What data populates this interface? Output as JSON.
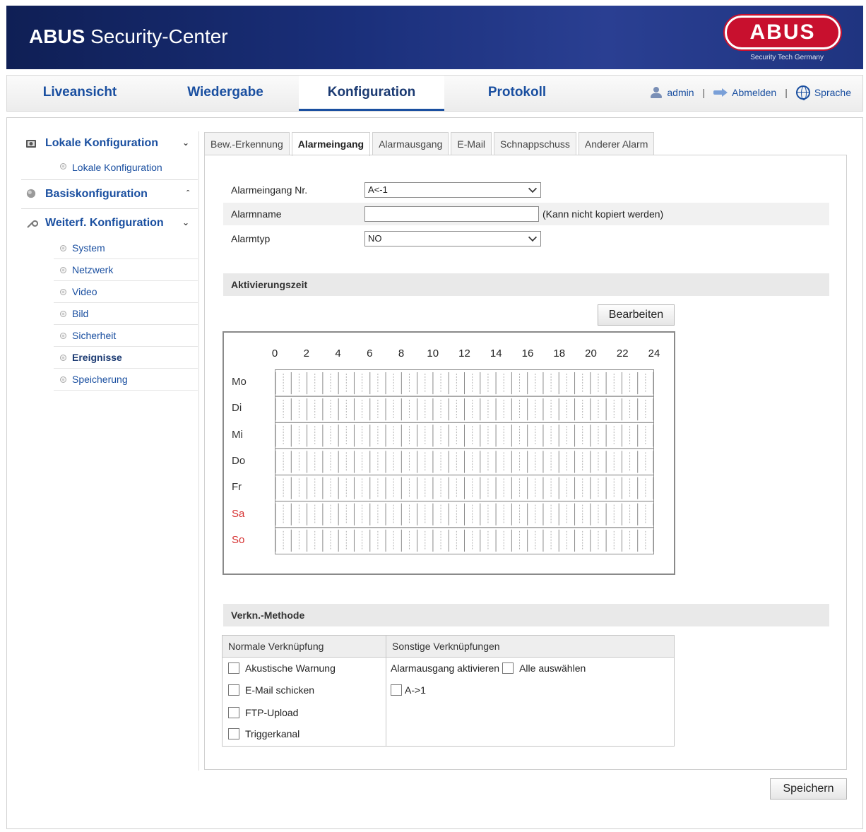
{
  "header": {
    "title_bold": "ABUS",
    "title_rest": " Security-Center",
    "logo_text": "ABUS",
    "logo_subtitle": "Security Tech Germany",
    "logo_color": "#c8102e"
  },
  "topnav": {
    "tabs": [
      {
        "label": "Liveansicht"
      },
      {
        "label": "Wiedergabe"
      },
      {
        "label": "Konfiguration",
        "active": true
      },
      {
        "label": "Protokoll"
      }
    ],
    "user": "admin",
    "logout": "Abmelden",
    "language": "Sprache",
    "separator": "|"
  },
  "sidebar": {
    "groups": [
      {
        "label": "Lokale Konfiguration",
        "icon": "camera-icon",
        "expanded": true
      },
      {
        "label": "Basiskonfiguration",
        "icon": "sphere-icon",
        "expanded": false
      },
      {
        "label": "Weiterf. Konfiguration",
        "icon": "wrench-icon",
        "expanded": true
      }
    ],
    "local_items": [
      "Lokale Konfiguration"
    ],
    "advanced_items": [
      "System",
      "Netzwerk",
      "Video",
      "Bild",
      "Sicherheit",
      "Ereignisse",
      "Speicherung"
    ],
    "active_item": "Ereignisse"
  },
  "subtabs": [
    "Bew.-Erkennung",
    "Alarmeingang",
    "Alarmausgang",
    "E-Mail",
    "Schnappschuss",
    "Anderer Alarm"
  ],
  "active_subtab": "Alarmeingang",
  "form": {
    "alarm_input_label": "Alarmeingang Nr.",
    "alarm_input_value": "A<-1",
    "alarm_name_label": "Alarmname",
    "alarm_name_value": "",
    "alarm_name_hint": "(Kann nicht kopiert werden)",
    "alarm_type_label": "Alarmtyp",
    "alarm_type_value": "NO"
  },
  "schedule": {
    "section_title": "Aktivierungszeit",
    "edit_button": "Bearbeiten",
    "hours": [
      "0",
      "2",
      "4",
      "6",
      "8",
      "10",
      "12",
      "14",
      "16",
      "18",
      "20",
      "22",
      "24"
    ],
    "days": [
      "Mo",
      "Di",
      "Mi",
      "Do",
      "Fr",
      "Sa",
      "So"
    ],
    "weekend_color": "#d63232"
  },
  "linkage": {
    "section_title": "Verkn.-Methode",
    "normal_header": "Normale Verknüpfung",
    "other_header": "Sonstige Verknüpfungen",
    "normal_items": [
      "Akustische Warnung",
      "E-Mail schicken",
      "FTP-Upload",
      "Triggerkanal"
    ],
    "alarm_out_label": "Alarmausgang aktivieren",
    "select_all_label": "Alle auswählen",
    "alarm_out_items": [
      "A->1"
    ]
  },
  "save_button": "Speichern"
}
